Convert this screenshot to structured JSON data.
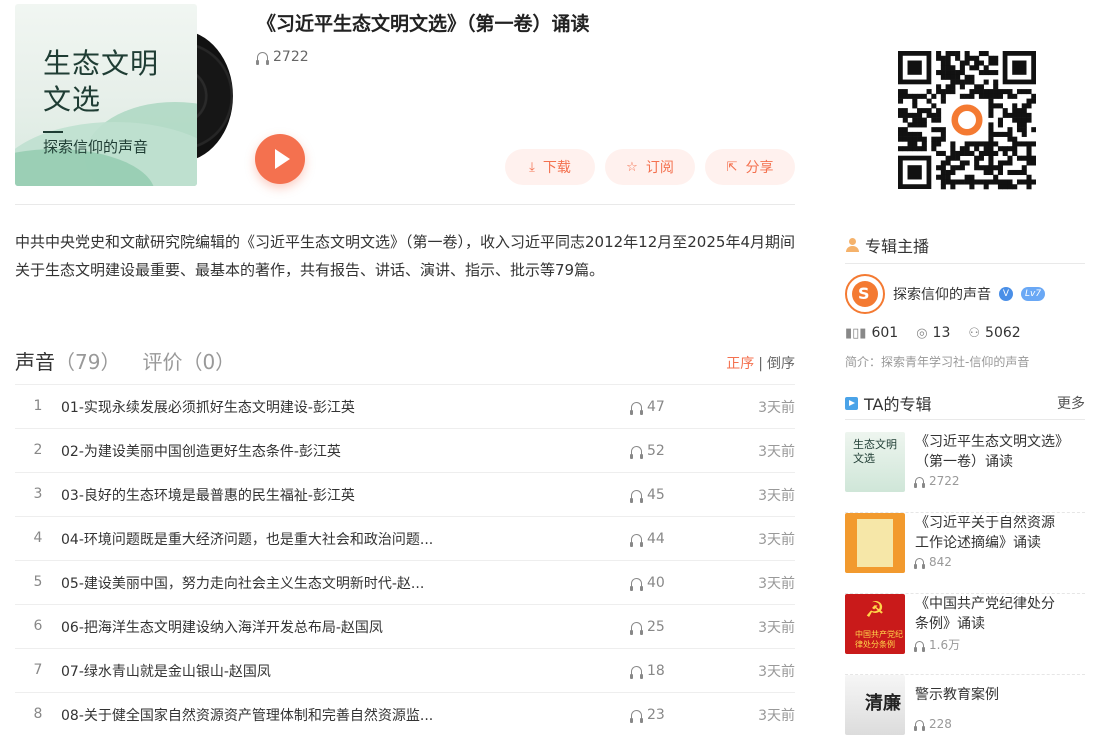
{
  "album": {
    "title": "《习近平生态文明文选》（第一卷）诵读",
    "play_count": "2722",
    "cover_title": "生态文明文选",
    "cover_line1": "生态文明",
    "cover_line2": "文选",
    "cover_subtitle": "探索信仰的声音",
    "actions": {
      "download": "下载",
      "subscribe": "订阅",
      "share": "分享"
    },
    "description": "中共中央党史和文献研究院编辑的《习近平生态文明文选》（第一卷），收入习近平同志2012年12月至2025年4月期间关于生态文明建设最重要、最基本的著作，共有报告、讲话、演讲、指示、批示等79篇。"
  },
  "tabs": {
    "sounds_label": "声音",
    "sounds_count": "（79）",
    "reviews_label": "评价",
    "reviews_count": "（0）"
  },
  "sort": {
    "asc": "正序",
    "separator": "|",
    "desc": "倒序"
  },
  "tracks": [
    {
      "index": "1",
      "title": "01-实现永续发展必须抓好生态文明建设-彭江英",
      "plays": "47",
      "time": "3天前"
    },
    {
      "index": "2",
      "title": "02-为建设美丽中国创造更好生态条件-彭江英",
      "plays": "52",
      "time": "3天前"
    },
    {
      "index": "3",
      "title": "03-良好的生态环境是最普惠的民生福祉-彭江英",
      "plays": "45",
      "time": "3天前"
    },
    {
      "index": "4",
      "title": "04-环境问题既是重大经济问题，也是重大社会和政治问题...",
      "plays": "44",
      "time": "3天前"
    },
    {
      "index": "5",
      "title": "05-建设美丽中国，努力走向社会主义生态文明新时代-赵...",
      "plays": "40",
      "time": "3天前"
    },
    {
      "index": "6",
      "title": "06-把海洋生态文明建设纳入海洋开发总布局-赵国凤",
      "plays": "25",
      "time": "3天前"
    },
    {
      "index": "7",
      "title": "07-绿水青山就是金山银山-赵国凤",
      "plays": "18",
      "time": "3天前"
    },
    {
      "index": "8",
      "title": "08-关于健全国家自然资源资产管理体制和完善自然资源监...",
      "plays": "23",
      "time": "3天前"
    }
  ],
  "anchor": {
    "heading": "专辑主播",
    "name": "探索信仰的声音",
    "verified": "V",
    "level": "Lv7",
    "stats": {
      "tracks": "601",
      "albums": "13",
      "followers": "5062"
    },
    "bio": "简介：探索青年学习社-信仰的声音"
  },
  "ta_albums": {
    "heading": "TA的专辑",
    "more": "更多",
    "items": [
      {
        "title": "《习近平生态文明文选》（第一卷）诵读",
        "plays": "2722",
        "thumb_text": "生态文明文选"
      },
      {
        "title": "《习近平关于自然资源工作论述摘编》诵读",
        "plays": "842"
      },
      {
        "title": "《中国共产党纪律处分条例》诵读",
        "plays": "1.6万",
        "thumb_text": "中国共产党纪律处分条例"
      },
      {
        "title": "警示教育案例",
        "plays": "228",
        "thumb_text": "清廉"
      }
    ]
  },
  "colors": {
    "accent": "#f4714f",
    "accent_bg": "#fff1ee",
    "text": "#333333",
    "muted": "#999999",
    "verified": "#4a8fe7"
  },
  "icons": {
    "headphones": "headphones-icon",
    "download": "download-icon",
    "star": "star-icon",
    "share": "share-icon"
  }
}
